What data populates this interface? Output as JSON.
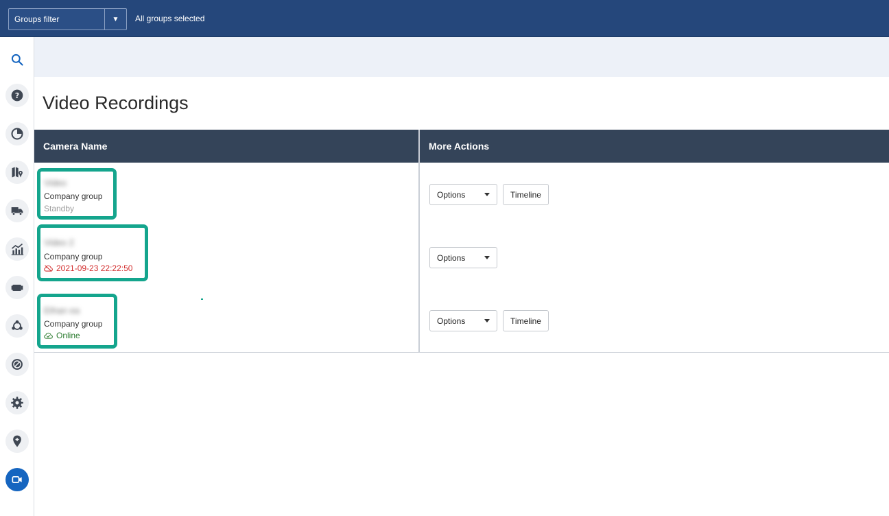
{
  "topbar": {
    "groups_filter_label": "Groups filter",
    "groups_status": "All groups selected"
  },
  "sidebar": {
    "items": [
      {
        "icon": "search-icon",
        "active": false
      },
      {
        "icon": "help-icon",
        "active": false
      },
      {
        "icon": "dashboard-icon",
        "active": false
      },
      {
        "icon": "map-icon",
        "active": false
      },
      {
        "icon": "truck-icon",
        "active": false
      },
      {
        "icon": "reports-icon",
        "active": false
      },
      {
        "icon": "camera-icon",
        "active": false
      },
      {
        "icon": "integrations-icon",
        "active": false
      },
      {
        "icon": "exceptions-icon",
        "active": false
      },
      {
        "icon": "settings-icon",
        "active": false
      },
      {
        "icon": "zone-icon",
        "active": false
      },
      {
        "icon": "video-icon",
        "active": true
      }
    ]
  },
  "page": {
    "title": "Video Recordings"
  },
  "table": {
    "columns": [
      "Camera Name",
      "More Actions"
    ],
    "rows": [
      {
        "name": "Video",
        "group": "Company group",
        "status": "Standby",
        "status_type": "standby",
        "actions": [
          "Options",
          "Timeline"
        ]
      },
      {
        "name": "Video 2",
        "group": "Company group",
        "status": "2021-09-23 22:22:50",
        "status_type": "error",
        "actions": [
          "Options"
        ]
      },
      {
        "name": "Ethan ea",
        "group": "Company group",
        "status": "Online",
        "status_type": "online",
        "actions": [
          "Options",
          "Timeline"
        ]
      }
    ]
  },
  "colors": {
    "topbar": "#25477b",
    "highlight": "#14a58d",
    "table_header": "#344459",
    "active_nav": "#1565c0",
    "error": "#d32f2f",
    "online": "#2e7d32"
  }
}
